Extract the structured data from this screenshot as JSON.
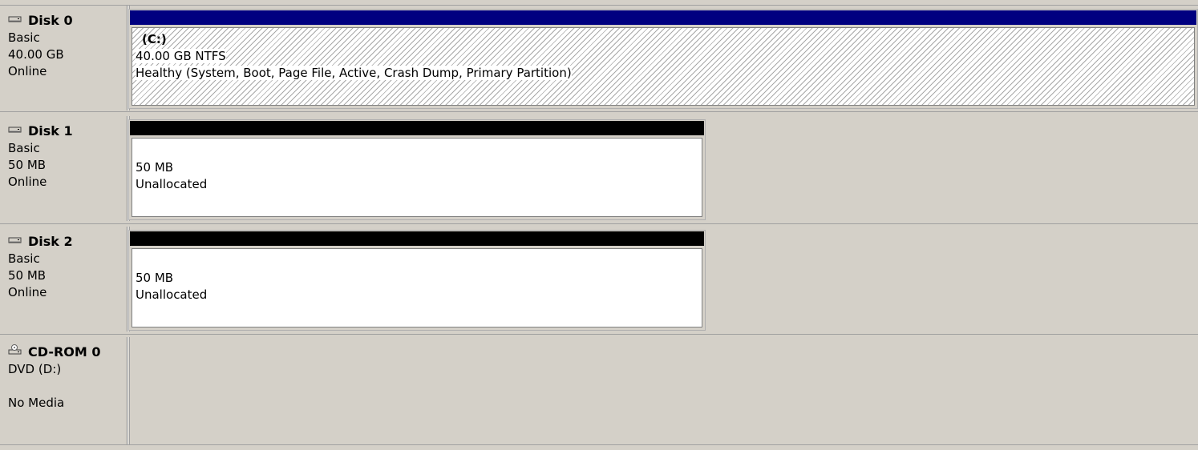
{
  "disks": [
    {
      "name": "Disk 0",
      "icon": "hard-disk-icon",
      "type": "Basic",
      "size": "40.00 GB",
      "status": "Online",
      "partition": {
        "volume": "(C:)",
        "size_fs": "40.00 GB NTFS",
        "health": "Healthy (System, Boot, Page File, Active, Crash Dump, Primary Partition)",
        "bar_color": "#000080"
      }
    },
    {
      "name": "Disk 1",
      "icon": "hard-disk-icon",
      "type": "Basic",
      "size": "50 MB",
      "status": "Online",
      "partition": {
        "size": "50 MB",
        "state": "Unallocated",
        "bar_color": "#000000"
      }
    },
    {
      "name": "Disk 2",
      "icon": "hard-disk-icon",
      "type": "Basic",
      "size": "50 MB",
      "status": "Online",
      "partition": {
        "size": "50 MB",
        "state": "Unallocated",
        "bar_color": "#000000"
      }
    },
    {
      "name": "CD-ROM 0",
      "icon": "cd-rom-icon",
      "type": "DVD (D:)",
      "status": "No Media"
    }
  ]
}
